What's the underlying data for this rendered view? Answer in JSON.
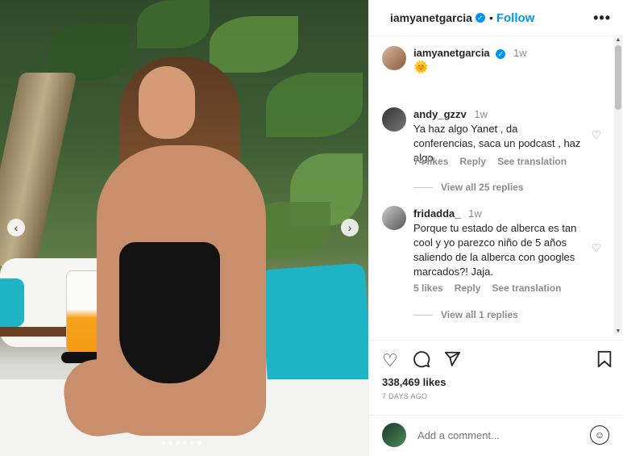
{
  "post": {
    "username": "iamyanetgarcia",
    "follow_label": "Follow",
    "separator": "•",
    "more_label": "•••"
  },
  "caption": {
    "username": "iamyanetgarcia",
    "time": "1w",
    "text": "🌞"
  },
  "comments": [
    {
      "username": "andy_gzzv",
      "time": "1w",
      "text": "Ya haz algo Yanet , da conferencias, saca un podcast , haz algo",
      "likes": "74 likes",
      "reply_label": "Reply",
      "translate_label": "See translation",
      "view_replies": "View all 25 replies"
    },
    {
      "username": "fridadda_",
      "time": "1w",
      "text": "Porque tu estado de alberca es tan cool y yo parezco niño de 5 años saliendo de la alberca con googles marcados?! Jaja.",
      "likes": "5 likes",
      "reply_label": "Reply",
      "translate_label": "See translation",
      "view_replies": "View all 1 replies"
    }
  ],
  "stats": {
    "likes": "338,469 likes",
    "date": "7 DAYS AGO"
  },
  "comment_box": {
    "placeholder": "Add a comment..."
  },
  "carousel": {
    "total": 6,
    "active_index": 5
  },
  "colors": {
    "accent": "#0095f6",
    "cushion": "#1fb3c6"
  },
  "icons": {
    "like": "heart-icon",
    "comment": "comment-icon",
    "share": "send-icon",
    "save": "bookmark-icon",
    "emoji": "smiley-icon"
  }
}
